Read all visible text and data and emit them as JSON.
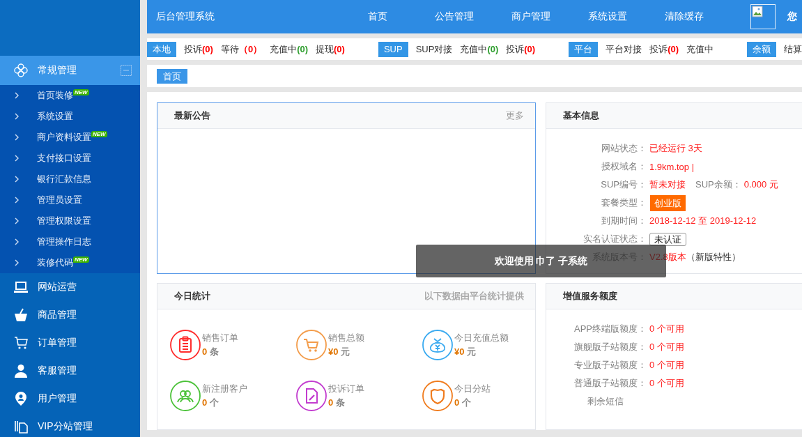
{
  "sidebar": {
    "items": [
      {
        "label": "常规管理",
        "expanded": true,
        "children": [
          {
            "label": "首页装修",
            "badge": "NEW"
          },
          {
            "label": "系统设置"
          },
          {
            "label": "商户资料设置",
            "badge": "NEW"
          },
          {
            "label": "支付接口设置"
          },
          {
            "label": "银行汇款信息"
          },
          {
            "label": "管理员设置"
          },
          {
            "label": "管理权限设置"
          },
          {
            "label": "管理操作日志"
          },
          {
            "label": "装修代码",
            "badge": "NEW"
          }
        ]
      },
      {
        "label": "网站运营",
        "expanded": false
      },
      {
        "label": "商品管理",
        "expanded": false
      },
      {
        "label": "订单管理",
        "expanded": false
      },
      {
        "label": "客服管理",
        "expanded": false
      },
      {
        "label": "用户管理",
        "expanded": false
      },
      {
        "label": "VIP分站管理",
        "expanded": false
      }
    ]
  },
  "header": {
    "title": "后台管理系统",
    "nav": [
      "首页",
      "公告管理",
      "商户管理",
      "系统设置",
      "清除缓存"
    ],
    "greeting": "您"
  },
  "status_strip": {
    "groups": [
      {
        "tag": "本地",
        "items": [
          {
            "label": "投诉",
            "count": "(0)",
            "color": "#ff0000"
          },
          {
            "label": "等待",
            "count": "（0）",
            "color": "#ff0000"
          },
          {
            "label": "充值中",
            "count": "(0)",
            "color": "#2e9e2e"
          },
          {
            "label": "提现",
            "count": "(0)",
            "color": "#ff0000"
          }
        ]
      },
      {
        "tag": "SUP",
        "items": [
          {
            "label": "SUP对接"
          },
          {
            "label": "充值中",
            "count": "(0)",
            "color": "#2e9e2e"
          },
          {
            "label": "投诉",
            "count": "(0)",
            "color": "#ff0000"
          }
        ]
      },
      {
        "tag": "平台",
        "items": [
          {
            "label": "平台对接"
          },
          {
            "label": "投诉",
            "count": "(0)",
            "color": "#ff0000"
          },
          {
            "label": "充值中"
          }
        ]
      },
      {
        "tag": "余额",
        "items": [
          {
            "label": "结算"
          }
        ]
      }
    ]
  },
  "breadcrumb": {
    "tabs": [
      {
        "label": "首页",
        "selected": true
      }
    ]
  },
  "notice_panel": {
    "title": "最新公告",
    "more": "更多",
    "focused": true
  },
  "basic_info": {
    "title": "基本信息",
    "focused": false,
    "rows": [
      {
        "kind": "text",
        "label": "网站状态：",
        "value": "已经运行 3天"
      },
      {
        "kind": "text",
        "label": "授权域名：",
        "value": "1.9km.top |"
      },
      {
        "kind": "pair",
        "label": "SUP编号：",
        "value": "暂未对接",
        "label_2": "SUP余额：",
        "value_2": "0.000 元"
      },
      {
        "kind": "badge",
        "label": "套餐类型：",
        "value": "创业版"
      },
      {
        "kind": "text",
        "label": "到期时间：",
        "value": "2018-12-12 至 2019-12-12"
      },
      {
        "kind": "tag",
        "label": "实名认证状态：",
        "value": "未认证"
      },
      {
        "kind": "version",
        "label": "系统版本号：",
        "value": "V2.8版本",
        "note": "（新版特性）"
      }
    ]
  },
  "today_stats": {
    "title": "今日统计",
    "note": "以下数据由平台统计提供",
    "focused": false,
    "items": [
      {
        "label": "销售订单",
        "value": "0",
        "unit": "条",
        "color": "#ff2d2d"
      },
      {
        "label": "销售总额",
        "value": "¥0",
        "unit": "元",
        "color": "#f39c4a"
      },
      {
        "label": "今日充值总额",
        "value": "¥0",
        "unit": "元",
        "color": "#3aaaf0"
      },
      {
        "label": "新注册客户",
        "value": "0",
        "unit": "个",
        "color": "#4cc23a"
      },
      {
        "label": "投诉订单",
        "value": "0",
        "unit": "条",
        "color": "#c23ccf"
      },
      {
        "label": "今日分站",
        "value": "0",
        "unit": "个",
        "color": "#f07c1e"
      }
    ]
  },
  "value_added": {
    "title": "增值服务额度",
    "focused": false,
    "rows": [
      {
        "kind": "quota",
        "label": "APP终端版额度：",
        "value": "0 个可用"
      },
      {
        "kind": "quota",
        "label": "旗舰版子站额度：",
        "value": "0 个可用"
      },
      {
        "kind": "quota",
        "label": "专业版子站额度：",
        "value": "0 个可用"
      },
      {
        "kind": "quota",
        "label": "普通版子站额度：",
        "value": "0 个可用"
      },
      {
        "kind": "cut",
        "label": "剩余短信"
      }
    ]
  },
  "toast": {
    "text": "欢迎使用 巾了 子系统"
  }
}
